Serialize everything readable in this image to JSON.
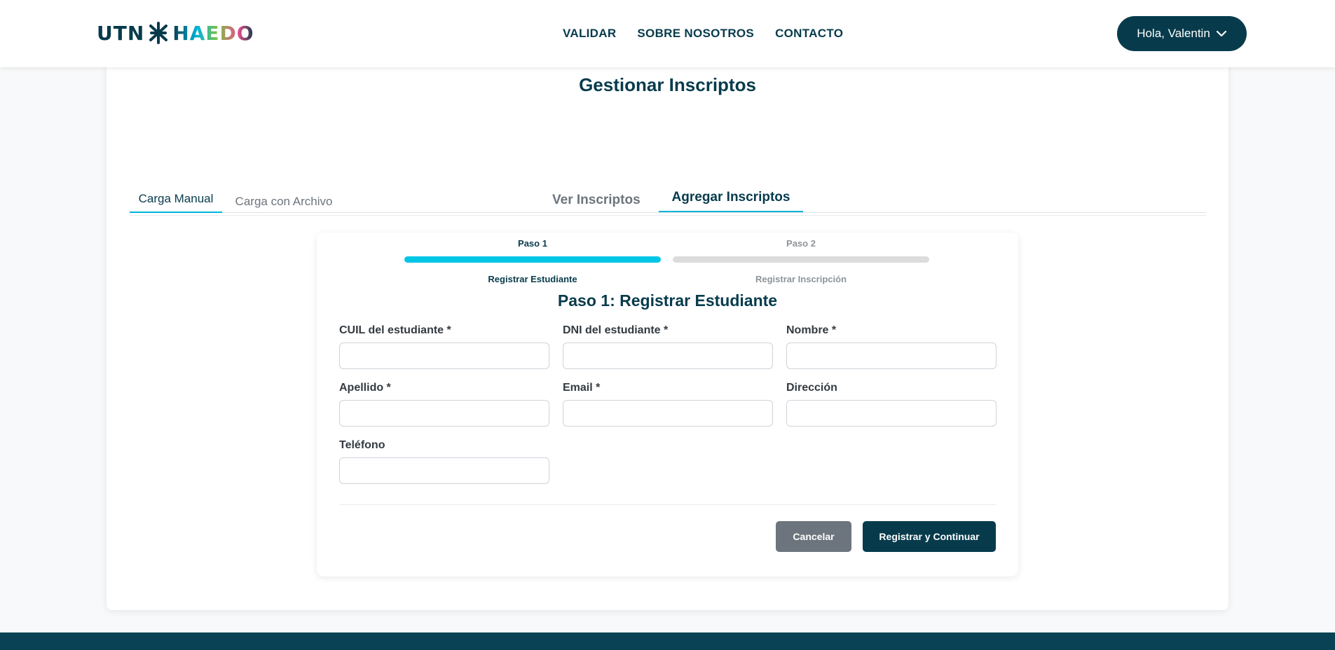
{
  "header": {
    "logo": {
      "part1": "UTN",
      "part2": "HAEDO"
    },
    "nav": [
      {
        "label": "VALIDAR"
      },
      {
        "label": "SOBRE NOSOTROS"
      },
      {
        "label": "CONTACTO"
      }
    ],
    "user_menu": {
      "label": "Hola, Valentin",
      "icon": "chevron-down-icon"
    }
  },
  "page": {
    "title": "Gestionar Inscriptos",
    "tabs": [
      {
        "label": "Ver Inscriptos",
        "active": false
      },
      {
        "label": "Agregar Inscriptos",
        "active": true
      }
    ],
    "subtabs": [
      {
        "label": "Carga Manual",
        "active": true
      },
      {
        "label": "Carga con Archivo",
        "active": false
      }
    ]
  },
  "wizard": {
    "steps": [
      {
        "label": "Paso 1",
        "sublabel": "Registrar Estudiante",
        "progress": 1.0
      },
      {
        "label": "Paso 2",
        "sublabel": "Registrar Inscripción",
        "progress": 0.0
      }
    ],
    "form_title": "Paso 1: Registrar Estudiante",
    "fields": {
      "cuil": {
        "label": "CUIL del estudiante *",
        "value": ""
      },
      "dni": {
        "label": "DNI del estudiante *",
        "value": ""
      },
      "nombre": {
        "label": "Nombre *",
        "value": ""
      },
      "apellido": {
        "label": "Apellido *",
        "value": ""
      },
      "email": {
        "label": "Email *",
        "value": ""
      },
      "direccion": {
        "label": "Dirección",
        "value": ""
      },
      "telefono": {
        "label": "Teléfono",
        "value": ""
      }
    },
    "buttons": {
      "cancel": "Cancelar",
      "submit": "Registrar y Continuar"
    }
  },
  "colors": {
    "primary": "#073b4c",
    "accent": "#00b4d8",
    "secondary_button": "#6c757d",
    "footer": "#084254"
  }
}
